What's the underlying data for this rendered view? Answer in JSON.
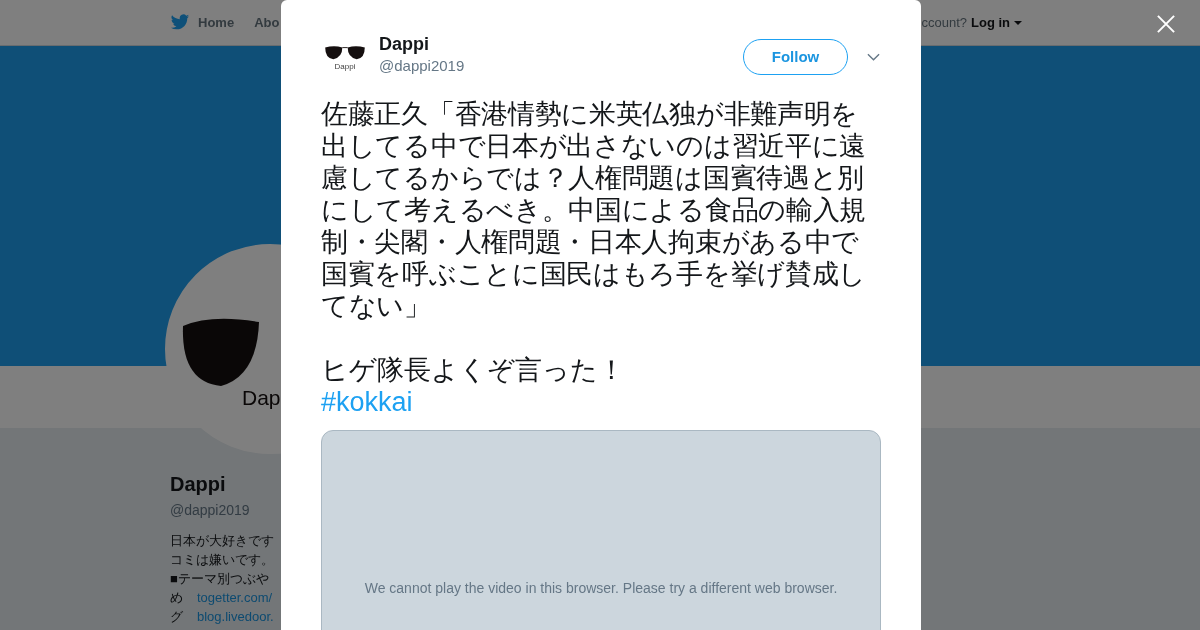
{
  "page": {
    "nav": [
      {
        "label": "Home",
        "kind": "home"
      },
      {
        "label": "Abo",
        "kind": "plain"
      }
    ],
    "login_prompt": "ccount?",
    "login_link": "Log in",
    "avatar_logo_text": "Dap",
    "profile_name": "Dappi",
    "profile_handle": "@dappi2019",
    "bio_lines": [
      "日本が大好きです",
      "コミは嫌いです。",
      "■テーマ別つぶや"
    ],
    "links": [
      {
        "prefix": "め",
        "url": "togetter.com/"
      },
      {
        "prefix": "グ",
        "url": "blog.livedoor."
      }
    ]
  },
  "modal": {
    "avatar_logo_text": "Dappi",
    "name": "Dappi",
    "handle": "@dappi2019",
    "follow_button": "Follow",
    "tweet_text": "佐藤正久「香港情勢に米英仏独が非難声明を出してる中で日本が出さないのは習近平に遠慮してるからでは？人権問題は国賓待遇と別にして考えるべき。中国による食品の輸入規制・尖閣・人権問題・日本人拘束がある中で国賓を呼ぶことに国民はもろ手を挙げ賛成してない」",
    "tweet_text_2": "ヒゲ隊長よくぞ言った！",
    "hashtag": "#kokkai",
    "video_message": "We cannot play the video in this browser. Please try a different web browser."
  }
}
